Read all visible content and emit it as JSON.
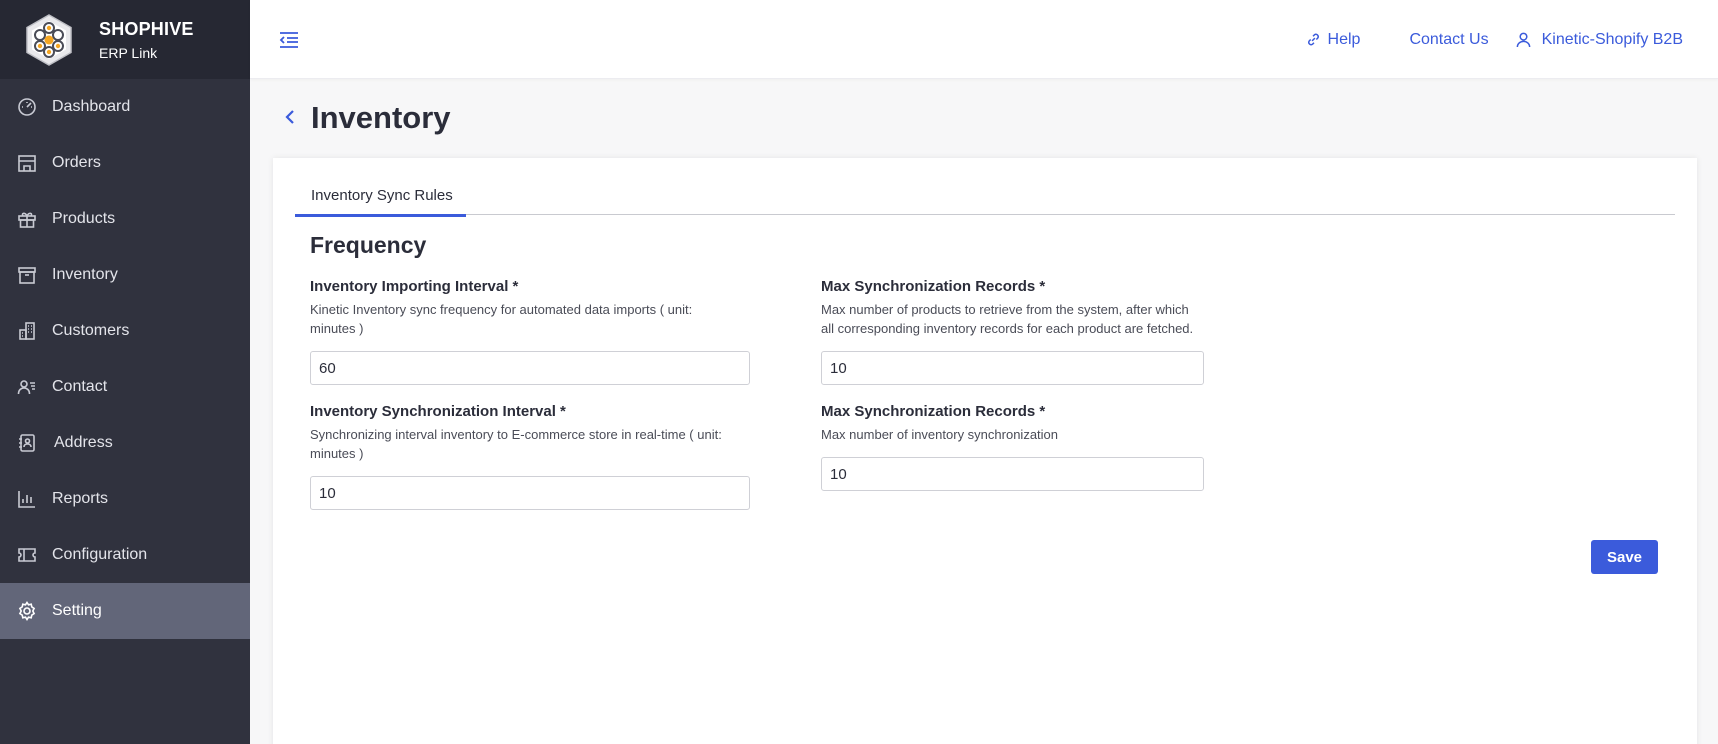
{
  "brand": {
    "title": "SHOPHIVE",
    "subtitle": "ERP Link"
  },
  "sidebar": {
    "items": [
      {
        "label": "Dashboard",
        "icon": "dashboard-icon"
      },
      {
        "label": "Orders",
        "icon": "store-icon"
      },
      {
        "label": "Products",
        "icon": "gift-icon"
      },
      {
        "label": "Inventory",
        "icon": "archive-icon"
      },
      {
        "label": "Customers",
        "icon": "buildings-icon"
      },
      {
        "label": "Contact",
        "icon": "contact-card-icon"
      },
      {
        "label": "Address",
        "icon": "address-book-icon"
      },
      {
        "label": "Reports",
        "icon": "bar-chart-icon"
      },
      {
        "label": "Configuration",
        "icon": "ticket-icon"
      },
      {
        "label": "Setting",
        "icon": "gear-icon",
        "active": true
      }
    ]
  },
  "topbar": {
    "help": "Help",
    "contact": "Contact Us",
    "user": "Kinetic-Shopify B2B"
  },
  "page": {
    "title": "Inventory"
  },
  "tabs": [
    {
      "label": "Inventory Sync Rules",
      "active": true
    }
  ],
  "section": {
    "title": "Frequency"
  },
  "fields": {
    "importing_interval": {
      "label": "Inventory Importing Interval *",
      "help": "Kinetic Inventory sync frequency for automated data imports ( unit: minutes )",
      "value": "60"
    },
    "max_records_1": {
      "label": "Max Synchronization Records *",
      "help": "Max number of products to retrieve from the system, after which all corresponding inventory records for each product are fetched.",
      "value": "10"
    },
    "sync_interval": {
      "label": "Inventory Synchronization Interval *",
      "help": "Synchronizing interval inventory to E-commerce store in real-time ( unit: minutes )",
      "value": "10"
    },
    "max_records_2": {
      "label": "Max Synchronization Records *",
      "help": "Max number of inventory synchronization",
      "value": "10"
    }
  },
  "actions": {
    "save": "Save"
  },
  "colors": {
    "accent": "#3b5bdb",
    "sidebar_bg": "#30323e",
    "sidebar_active": "#626679",
    "brand_bg": "#262833"
  }
}
